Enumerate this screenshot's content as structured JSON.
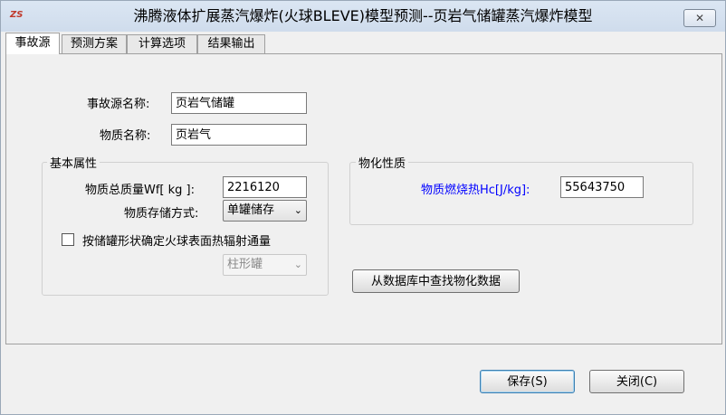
{
  "window": {
    "title": "沸腾液体扩展蒸汽爆炸(火球BLEVE)模型预测--页岩气储罐蒸汽爆炸模型",
    "app_icon_text": "ZS",
    "close_glyph": "✕"
  },
  "tabs": [
    {
      "label": "事故源",
      "active": true
    },
    {
      "label": "预测方案",
      "active": false
    },
    {
      "label": "计算选项",
      "active": false
    },
    {
      "label": "结果输出",
      "active": false
    }
  ],
  "form": {
    "source_name_label": "事故源名称:",
    "source_name_value": "页岩气储罐",
    "substance_name_label": "物质名称:",
    "substance_name_value": "页岩气"
  },
  "basic_props": {
    "title": "基本属性",
    "total_mass_label": "物质总质量Wf[ kg ]:",
    "total_mass_value": "2216120",
    "storage_label": "物质存储方式:",
    "storage_value": "单罐储存",
    "checkbox_label": "按储罐形状确定火球表面热辐射通量",
    "checkbox_checked": false,
    "shape_value": "柱形罐",
    "shape_enabled": false
  },
  "physchem": {
    "title": "物化性质",
    "heat_label": "物质燃烧热Hc[J/kg]:",
    "heat_value": "55643750",
    "label_color": "#0000ff"
  },
  "buttons": {
    "lookup": "从数据库中查找物化数据",
    "save": "保存(S)",
    "close": "关闭(C)"
  }
}
